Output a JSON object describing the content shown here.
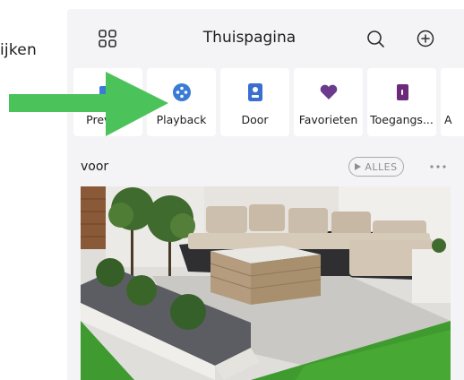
{
  "side_text": "ijken",
  "header": {
    "title": "Thuispagina"
  },
  "nav": [
    {
      "label": "Preview",
      "icon": "preview-icon",
      "color": "#3a7bd5"
    },
    {
      "label": "Playback",
      "icon": "playback-icon",
      "color": "#3a7bd5"
    },
    {
      "label": "Door",
      "icon": "door-icon",
      "color": "#3a6fd0"
    },
    {
      "label": "Favorieten",
      "icon": "heart-icon",
      "color": "#6b3a8c"
    },
    {
      "label": "Toegangs...",
      "icon": "access-icon",
      "color": "#6b2a7a"
    },
    {
      "label": "A",
      "icon": "more-feature-icon",
      "color": "#3a7bd5"
    }
  ],
  "section": {
    "title": "voor",
    "all_label": "ALLES"
  },
  "colors": {
    "arrow": "#4cc35a",
    "background": "#f4f4f6",
    "tile": "#ffffff"
  }
}
